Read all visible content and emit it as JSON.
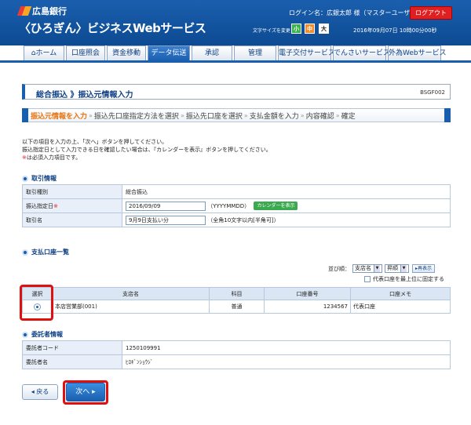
{
  "header": {
    "bank_name": "広島銀行",
    "service_name": "〈ひろぎん〉ビジネスWebサービス",
    "user_label": "ログイン名：広銀太郎 様（マスターユーザ）",
    "logout_label": "ログアウト",
    "fontsize_label": "文字サイズを変更",
    "fontsize_small": "小",
    "fontsize_mid": "中",
    "fontsize_large": "大",
    "datetime": "2016年09月07日 10時00分00秒"
  },
  "nav": [
    {
      "label": "ホーム"
    },
    {
      "label": "口座照会"
    },
    {
      "label": "資金移動"
    },
    {
      "label": "データ伝送"
    },
    {
      "label": "承認"
    },
    {
      "label": "管理"
    },
    {
      "label": "電子交付サービス"
    },
    {
      "label": "でんさいサービス"
    },
    {
      "label": "外為Webサービス"
    }
  ],
  "page": {
    "title": "総合振込 》振込元情報入力",
    "code": "BSGF002"
  },
  "steps": [
    "振込元情報を入力",
    "振込先口座指定方法を選択",
    "振込先口座を選択",
    "支払金額を入力",
    "内容確認",
    "確定"
  ],
  "instructions": {
    "line1": "以下の項目を入力の上、「次へ」ボタンを押してください。",
    "line2": "振込指定日として入力できる日を確認したい場合は、『カレンダーを表示』ボタンを押してください。",
    "req_mark": "※",
    "line3": "は必須入力項目です。"
  },
  "transaction": {
    "section_title": "取引情報",
    "type_label": "取引種別",
    "type_value": "総合振込",
    "date_label": "振込指定日",
    "date_req": "※",
    "date_value": "2016/09/09",
    "date_format": "（YYYYMMDD）",
    "calendar_button": "カレンダーを表示",
    "name_label": "取引名",
    "name_value": "9月9日支払い分",
    "name_hint": "（全角10文字以内[半角可]）"
  },
  "accounts": {
    "section_title": "支払口座一覧",
    "sort_label": "並び順：",
    "sort_key": "支店名",
    "sort_order": "昇順",
    "redisplay_label": "再表示",
    "pin_label": "代表口座を最上位に固定する",
    "columns": [
      "選択",
      "支店名",
      "科目",
      "口座番号",
      "口座メモ"
    ],
    "rows": [
      {
        "branch": "本店営業部(001)",
        "type": "普通",
        "number": "1234567",
        "memo": "代表口座"
      }
    ]
  },
  "client": {
    "section_title": "委託者情報",
    "code_label": "委託者コード",
    "code_value": "1250109991",
    "name_label": "委託者名",
    "name_value": "ﾋﾛｷﾞﾝｼｮｳｼﾞ"
  },
  "buttons": {
    "back": "戻る",
    "next": "次へ"
  }
}
